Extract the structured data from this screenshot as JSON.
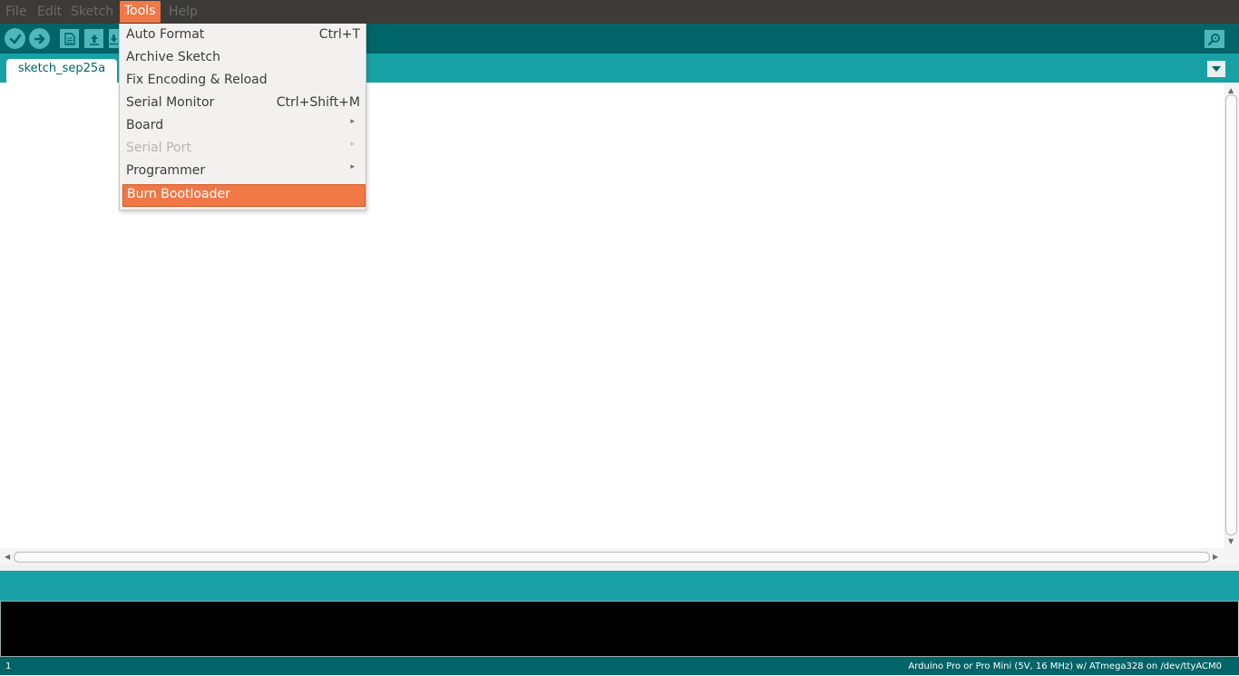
{
  "menubar": {
    "items": [
      {
        "label": "File"
      },
      {
        "label": "Edit"
      },
      {
        "label": "Sketch"
      },
      {
        "label": "Tools"
      },
      {
        "label": "Help"
      }
    ]
  },
  "toolbar": {
    "icons": [
      "verify-icon",
      "upload-icon",
      "new-icon",
      "open-icon",
      "save-icon",
      "serial-monitor-icon"
    ]
  },
  "tabs": {
    "active": "sketch_sep25a",
    "menu_icon": "chevron-down-icon"
  },
  "tools_menu": {
    "items": [
      {
        "label": "Auto Format",
        "shortcut": "Ctrl+T"
      },
      {
        "label": "Archive Sketch",
        "shortcut": ""
      },
      {
        "label": "Fix Encoding & Reload",
        "shortcut": ""
      },
      {
        "label": "Serial Monitor",
        "shortcut": "Ctrl+Shift+M"
      },
      {
        "label": "Board",
        "submenu": true
      },
      {
        "label": "Serial Port",
        "submenu": true,
        "disabled": true
      },
      {
        "label": "Programmer",
        "submenu": true
      },
      {
        "label": "Burn Bootloader",
        "highlighted": true
      }
    ]
  },
  "status": {
    "line": "1",
    "board": "Arduino Pro or Pro Mini (5V, 16 MHz) w/ ATmega328 on /dev/ttyACM0"
  },
  "colors": {
    "menubar_bg": "#3c3b37",
    "toolbar_bg": "#006468",
    "tabstrip_bg": "#17a1a5",
    "highlight": "#f07746",
    "console_bg": "#000000"
  }
}
